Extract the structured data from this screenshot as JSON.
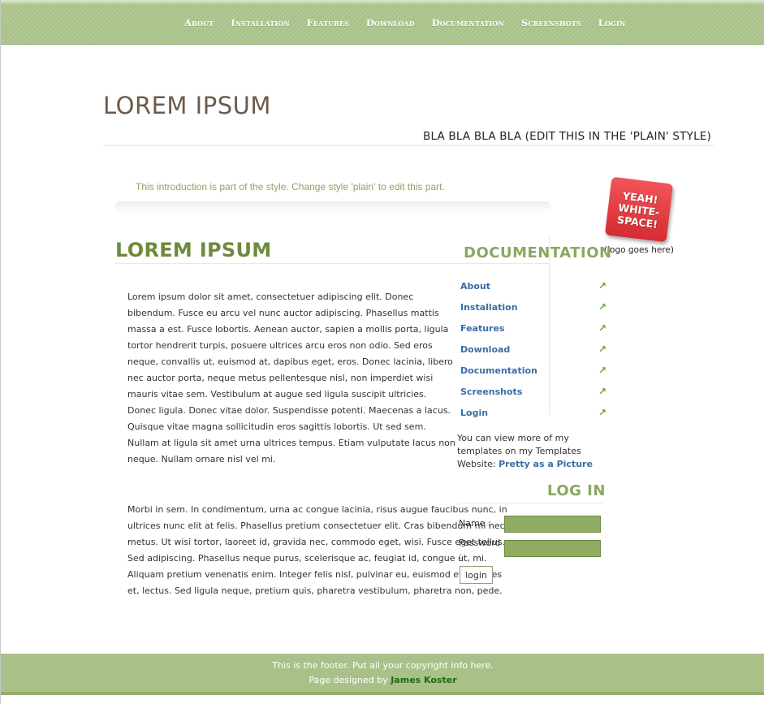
{
  "nav": {
    "items": [
      "About",
      "Installation",
      "Features",
      "Download",
      "Documentation",
      "Screenshots",
      "Login"
    ]
  },
  "header": {
    "title": "LOREM IPSUM",
    "tagline": "BLA BLA BLA BLA (EDIT THIS IN THE 'PLAIN' STYLE)"
  },
  "intro": "This introduction is part of the style. Change style 'plain' to edit this part.",
  "logo": {
    "badge_text": "YEAH!\nWHITE-\nSPACE!",
    "caption": "(logo goes here)"
  },
  "main": {
    "title": "LOREM IPSUM",
    "paragraphs": [
      "Lorem ipsum dolor sit amet, consectetuer adipiscing elit. Donec bibendum. Fusce eu arcu vel nunc auctor adipiscing. Phasellus mattis massa a est. Fusce lobortis. Aenean auctor, sapien a mollis porta, ligula tortor hendrerit turpis, posuere ultrices arcu eros non odio. Sed eros neque, convallis ut, euismod at, dapibus eget, eros. Donec lacinia, libero nec auctor porta, neque metus pellentesque nisl, non imperdiet wisi mauris vitae sem. Vestibulum at augue sed ligula suscipit ultricies. Donec ligula. Donec vitae dolor. Suspendisse potenti. Maecenas a lacus. Quisque vitae magna sollicitudin eros sagittis lobortis. Ut sed sem. Nullam at ligula sit amet urna ultrices tempus. Etiam vulputate lacus non neque. Nullam ornare nisl vel mi.",
      "Morbi in sem. In condimentum, urna ac congue lacinia, risus augue faucibus nunc, in ultrices nunc elit at felis. Phasellus pretium consectetuer elit. Cras bibendum mi nec metus. Ut wisi tortor, laoreet id, gravida nec, commodo eget, wisi. Fusce eget tellus. Sed adipiscing. Phasellus neque purus, scelerisque ac, feugiat id, congue ut, mi. Aliquam pretium venenatis enim. Integer felis nisl, pulvinar eu, euismod et, sodales et, lectus. Sed ligula neque, pretium quis, pharetra vestibulum, pharetra non, pede."
    ]
  },
  "sidebar": {
    "doc_title": "DOCUMENTATION",
    "doc_items": [
      "About",
      "Installation",
      "Features",
      "Download",
      "Documentation",
      "Screenshots",
      "Login"
    ],
    "arrow": "↗",
    "templates_text": "You can view more of my templates on my Templates Website: ",
    "templates_link": "Pretty as a Picture",
    "login_title": "LOG IN",
    "name_label": "Name :",
    "password_label": "Password :",
    "login_button": "login"
  },
  "footer": {
    "line1": "This is the footer. Put all your copyright info here.",
    "line2_prefix": "Page designed by ",
    "designer": "James Koster"
  },
  "colors": {
    "accent_green": "#a9c189",
    "title_green": "#6e8a3c",
    "link_blue": "#3a6ea5",
    "badge_red": "#e0383e"
  }
}
